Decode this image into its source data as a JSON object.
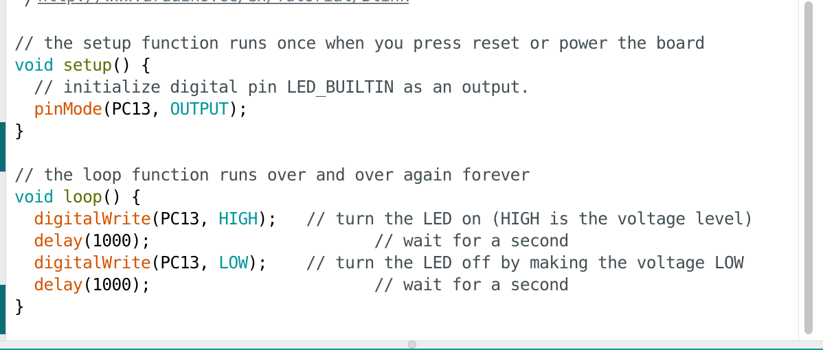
{
  "editor": {
    "url_fragment": "http://www.arduino.cc/en/Tutorial/Blink",
    "lines": [
      [
        {
          "t": "*/",
          "c": "comment"
        }
      ],
      [],
      [
        {
          "t": "// the setup function runs once when you press reset or power the board",
          "c": "comment"
        }
      ],
      [
        {
          "t": "void",
          "c": "type"
        },
        {
          "t": " ",
          "c": "plain"
        },
        {
          "t": "setup",
          "c": "name"
        },
        {
          "t": "() {",
          "c": "plain"
        }
      ],
      [
        {
          "t": "  // initialize digital pin LED_BUILTIN as an output.",
          "c": "comment"
        }
      ],
      [
        {
          "t": "  ",
          "c": "plain"
        },
        {
          "t": "pinMode",
          "c": "func"
        },
        {
          "t": "(PC13, ",
          "c": "plain"
        },
        {
          "t": "OUTPUT",
          "c": "const"
        },
        {
          "t": ");",
          "c": "plain"
        }
      ],
      [
        {
          "t": "}",
          "c": "plain"
        }
      ],
      [],
      [
        {
          "t": "// the loop function runs over and over again forever",
          "c": "comment"
        }
      ],
      [
        {
          "t": "void",
          "c": "type"
        },
        {
          "t": " ",
          "c": "plain"
        },
        {
          "t": "loop",
          "c": "name"
        },
        {
          "t": "() {",
          "c": "plain"
        }
      ],
      [
        {
          "t": "  ",
          "c": "plain"
        },
        {
          "t": "digitalWrite",
          "c": "func"
        },
        {
          "t": "(PC13, ",
          "c": "plain"
        },
        {
          "t": "HIGH",
          "c": "const"
        },
        {
          "t": ");   ",
          "c": "plain"
        },
        {
          "t": "// turn the LED on (HIGH is the voltage level)",
          "c": "comment"
        }
      ],
      [
        {
          "t": "  ",
          "c": "plain"
        },
        {
          "t": "delay",
          "c": "func"
        },
        {
          "t": "(1000);                       ",
          "c": "plain"
        },
        {
          "t": "// wait for a second",
          "c": "comment"
        }
      ],
      [
        {
          "t": "  ",
          "c": "plain"
        },
        {
          "t": "digitalWrite",
          "c": "func"
        },
        {
          "t": "(PC13, ",
          "c": "plain"
        },
        {
          "t": "LOW",
          "c": "const"
        },
        {
          "t": ");    ",
          "c": "plain"
        },
        {
          "t": "// turn the LED off by making the voltage LOW",
          "c": "comment"
        }
      ],
      [
        {
          "t": "  ",
          "c": "plain"
        },
        {
          "t": "delay",
          "c": "func"
        },
        {
          "t": "(1000);                       ",
          "c": "plain"
        },
        {
          "t": "// wait for a second",
          "c": "comment"
        }
      ],
      [
        {
          "t": "}",
          "c": "plain"
        }
      ]
    ]
  },
  "colors": {
    "comment": "#434f54",
    "type": "#00979c",
    "name": "#5e6d03",
    "func": "#d35400",
    "const": "#00979c",
    "plain": "#000000",
    "accent": "#00979c"
  }
}
